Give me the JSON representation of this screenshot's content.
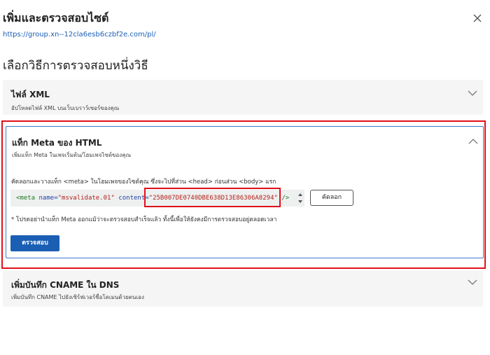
{
  "dialog": {
    "title": "เพิ่มและตรวจสอบไซต์",
    "url": "https://group.xn--12cla6esb6czbf2e.com/pl/",
    "subtitle": "เลือกวิธีการตรวจสอบหนึ่งวิธี"
  },
  "icons": {
    "close": "close-icon",
    "chevron_down": "chevron-down-icon",
    "chevron_up": "chevron-up-icon",
    "spin": "scroll-arrows-icon"
  },
  "colors": {
    "highlight": "#e0101a",
    "accent": "#1a5fb4",
    "panel_bg": "#f5f5f5"
  },
  "methods": {
    "xml": {
      "title": "ไฟล์ XML",
      "desc": "อัปโหลดไฟล์ XML บนเว็บเบราว์เซอร์ของคุณ"
    },
    "meta": {
      "title": "แท็ก Meta ของ HTML",
      "desc": "เพิ่มแท็ก Meta ในเพจเริ่มต้น/โฮมเพจไซต์ของคุณ",
      "instruction": "คัดลอกและวางแท็ก <meta> ในโฮมเพจของไซต์คุณ ซึ่งจะไปที่ส่วน <head> ก่อนส่วน <body> แรก",
      "code": {
        "open": "<meta",
        "name_attr": "name=",
        "name_val": "\"msvalidate.01\"",
        "content_attr": "content=",
        "content_val": "\"25B007DE0740DBE638D13E86306A8294\"",
        "close": "/>"
      },
      "copy_label": "คัดลอก",
      "note": "* โปรดอย่านำแท็ก Meta ออกแม้ว่าจะตรวจสอบสำเร็จแล้ว ทั้งนี้เพื่อให้ยังคงมีการตรวจสอบอยู่ตลอดเวลา",
      "verify_label": "ตรวจสอบ"
    },
    "cname": {
      "title": "เพิ่มบันทึก CNAME ใน DNS",
      "desc": "เพิ่มบันทึก CNAME ไปยังเซิร์ฟเวอร์ชื่อโดเมนด้วยตนเอง"
    }
  }
}
